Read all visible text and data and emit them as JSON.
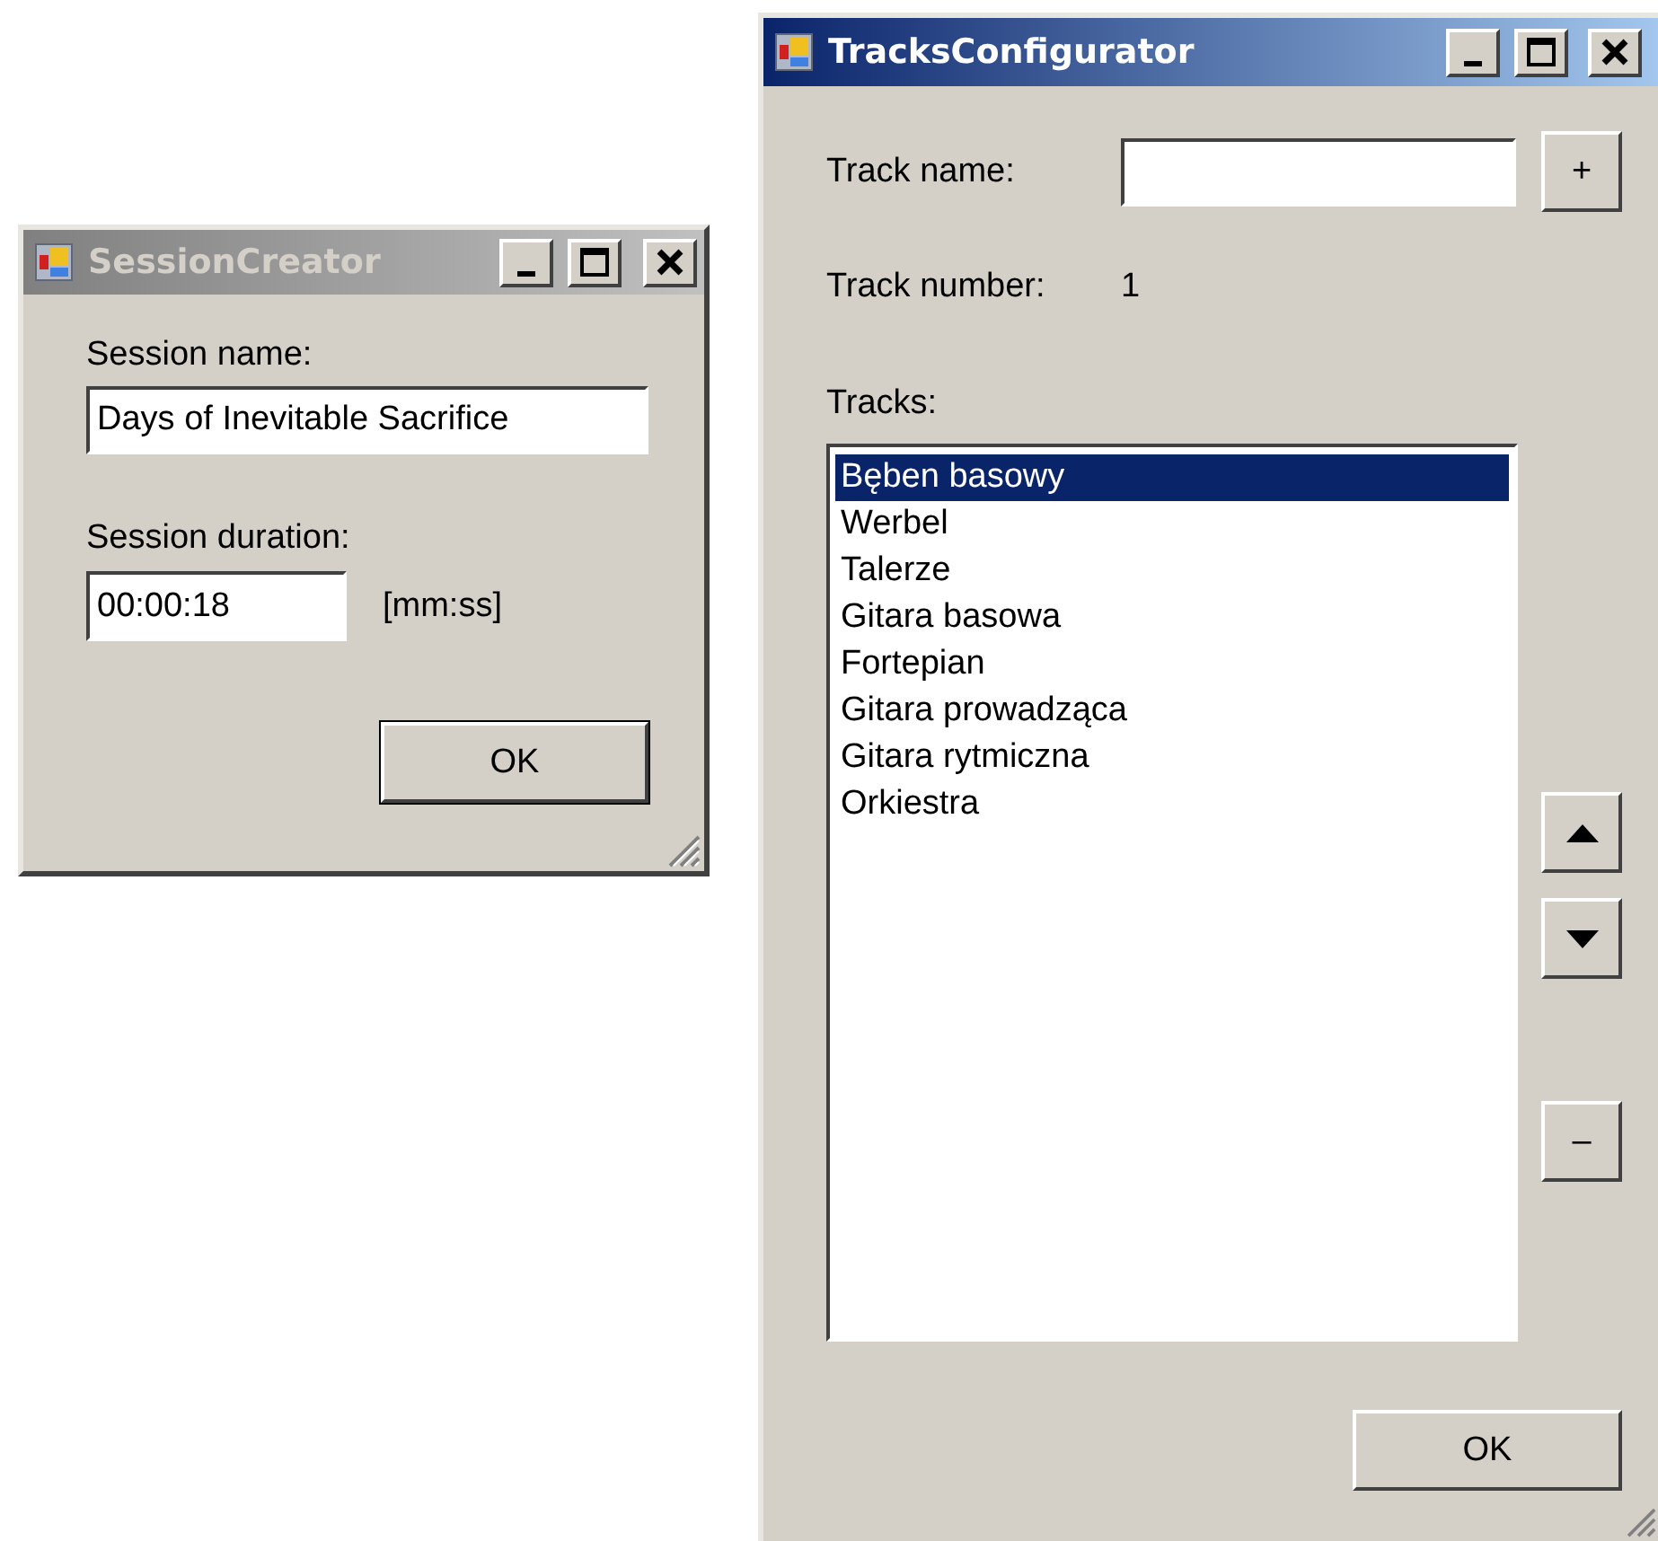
{
  "session_creator": {
    "title": "SessionCreator",
    "active": false,
    "name_label": "Session name:",
    "name_value": "Days of Inevitable Sacrifice",
    "duration_label": "Session duration:",
    "duration_value": "00:00:18",
    "duration_hint": "[mm:ss]",
    "ok": "OK"
  },
  "tracks_configurator": {
    "title": "TracksConfigurator",
    "active": true,
    "track_name_label": "Track name:",
    "add": "+",
    "track_number_label": "Track number:",
    "track_number": "1",
    "tracks_label": "Tracks:",
    "tracks": [
      {
        "label": "Bęben basowy",
        "selected": true
      },
      {
        "label": "Werbel",
        "selected": false
      },
      {
        "label": "Talerze",
        "selected": false
      },
      {
        "label": "Gitara basowa",
        "selected": false
      },
      {
        "label": "Fortepian",
        "selected": false
      },
      {
        "label": "Gitara prowadząca",
        "selected": false
      },
      {
        "label": "Gitara rytmiczna",
        "selected": false
      },
      {
        "label": "Orkiestra",
        "selected": false
      }
    ],
    "remove": "–",
    "ok": "OK"
  }
}
